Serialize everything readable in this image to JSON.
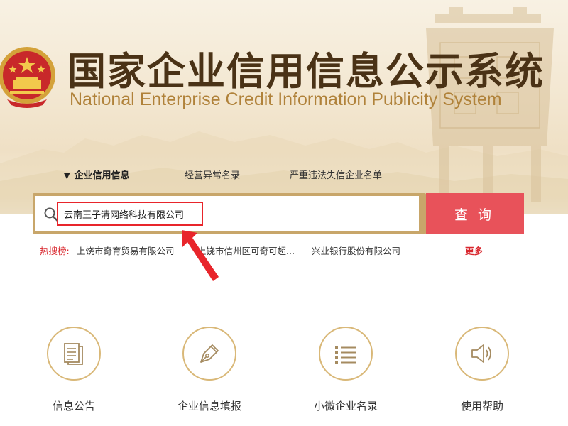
{
  "header": {
    "title_cn": "国家企业信用信息公示系统",
    "title_en": "National Enterprise Credit Information Publicity System"
  },
  "tabs": [
    {
      "label": "企业信用信息",
      "active": true
    },
    {
      "label": "经营异常名录"
    },
    {
      "label": "严重违法失信企业名单"
    }
  ],
  "search": {
    "value": "云南王子清网络科技有限公司",
    "button_label": "查询"
  },
  "hot_search": {
    "label": "热搜榜:",
    "items": [
      "上饶市奇育贸易有限公司",
      "上饶市信州区可奇可超...",
      "兴业银行股份有限公司"
    ],
    "more_label": "更多"
  },
  "services": [
    {
      "label": "信息公告",
      "icon": "document-icon"
    },
    {
      "label": "企业信息填报",
      "icon": "pen-nib-icon"
    },
    {
      "label": "小微企业名录",
      "icon": "list-icon"
    },
    {
      "label": "使用帮助",
      "icon": "speaker-icon"
    }
  ],
  "colors": {
    "accent_red": "#e8525a",
    "gold": "#c8a66a",
    "title_brown": "#4a3216",
    "subtitle_gold": "#b0823a",
    "highlight_red": "#e8252b"
  }
}
